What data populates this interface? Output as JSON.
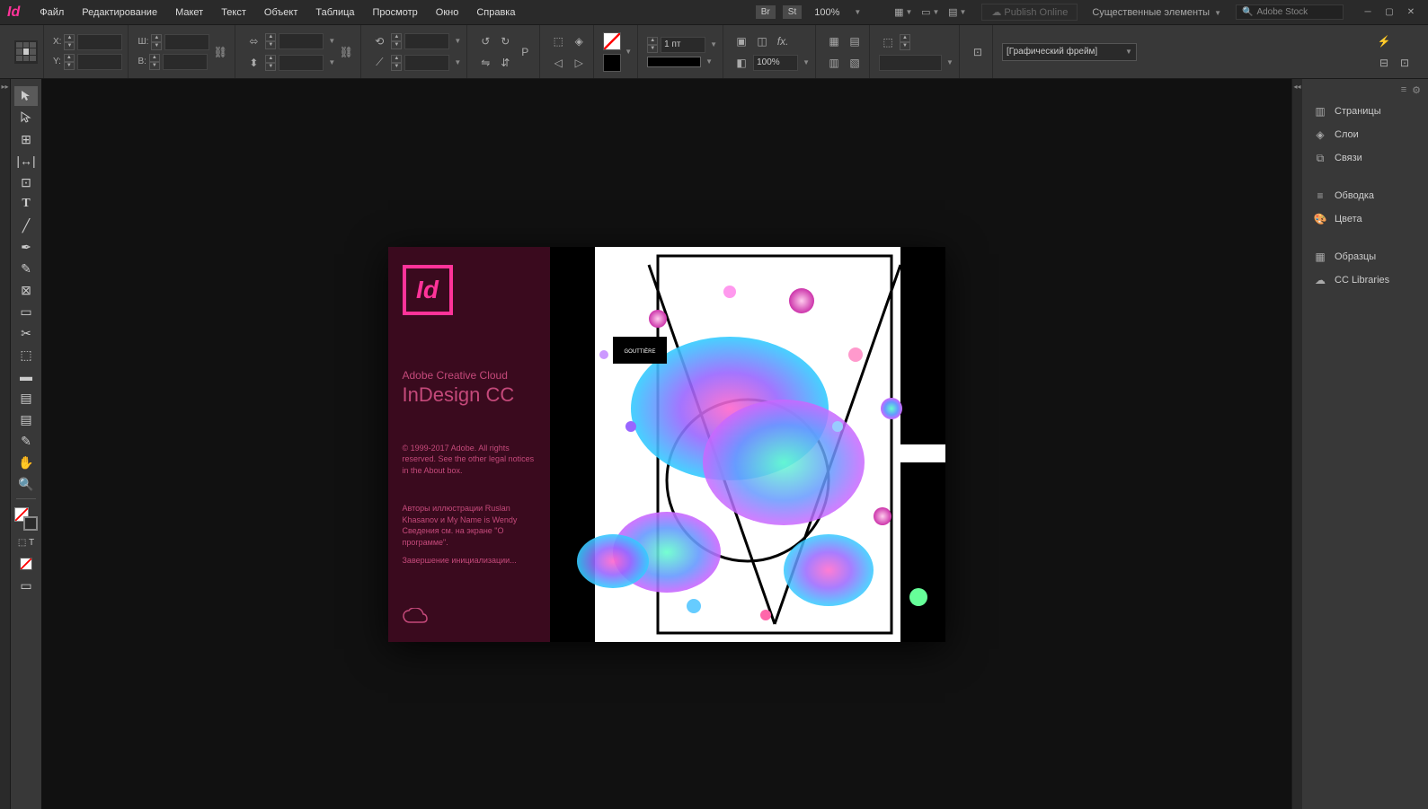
{
  "app": {
    "logo": "Id"
  },
  "menu": {
    "file": "Файл",
    "edit": "Редактирование",
    "layout": "Макет",
    "text": "Текст",
    "object": "Объект",
    "table": "Таблица",
    "view": "Просмотр",
    "window": "Окно",
    "help": "Справка"
  },
  "topbar": {
    "badge_br": "Br",
    "badge_st": "St",
    "zoom": "100%",
    "publish": "Publish Online",
    "workspace": "Существенные элементы",
    "search_placeholder": "Adobe Stock"
  },
  "controlbar": {
    "x_label": "X:",
    "y_label": "Y:",
    "w_label": "Ш:",
    "h_label": "В:",
    "stroke_weight": "1 пт",
    "opacity": "100%",
    "frame_type": "[Графический фрейм]"
  },
  "splash": {
    "logo": "Id",
    "cc_line": "Adobe Creative Cloud",
    "title": "InDesign CC",
    "copyright": "© 1999-2017 Adobe. All rights reserved. See the other legal notices in the About box.",
    "credits": "Авторы иллюстрации Ruslan Khasanov и My Name is Wendy Сведения см. на экране \"О программе\".",
    "status": "Завершение инициализации..."
  },
  "panels": {
    "pages": "Страницы",
    "layers": "Слои",
    "links": "Связи",
    "stroke": "Обводка",
    "color": "Цвета",
    "swatches": "Образцы",
    "cc_libraries": "CC Libraries"
  }
}
